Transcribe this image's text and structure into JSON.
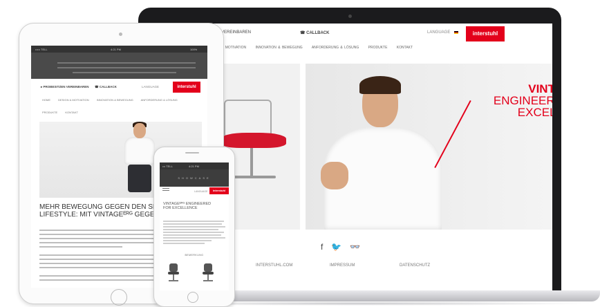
{
  "colors": {
    "brand_red": "#e3001b",
    "laptop_bezel": "#1b1b1d",
    "device_silver": "#fbfbfb"
  },
  "laptop": {
    "top_bar": {
      "appointment": "N VEREINBAREN",
      "callback": "CALLBACK",
      "language": "LANGUAGE",
      "logo": "interstuhl"
    },
    "nav": [
      "N & MOTIVATION",
      "INNOVATION & BEWEGUNG",
      "ANFORDERUNG & LÖSUNG",
      "PRODUKTE",
      "KONTAKT"
    ],
    "hero": {
      "line1": "VINTA",
      "line2": "ENGINEERE",
      "line3": "EXCELL"
    },
    "social_icons": [
      "facebook-icon",
      "twitter-icon",
      "tripadvisor-icon"
    ],
    "footer": [
      "INTERSTUHL.COM",
      "IMPRESSUM",
      "DATENSCHUTZ"
    ]
  },
  "tablet": {
    "status": {
      "carrier": "••••• TELL",
      "time": "4:21 PM",
      "battery": "100%"
    },
    "top_bar": {
      "appointment": "PROBESITZEN VEREINBAREN",
      "callback": "CALLBACK",
      "language": "LANGUAGE",
      "logo": "interstuhl"
    },
    "nav_row1": [
      "HOME",
      "DESIGN & MOTIVATION",
      "INNOVATION & BEWEGUNG",
      "ANFORDERUNG & LÖSUNG"
    ],
    "nav_row2": [
      "PRODUKTE",
      "KONTAKT"
    ],
    "headline": "MEHR BEWEGUNG GEGEN DEN SEDEN LIFESTYLE: MIT VINTAGEᴱᴿᴳ GEGEN DAS SITZEN"
  },
  "phone": {
    "status": {
      "carrier": "••• TELL",
      "time": "4:21 PM"
    },
    "nav_title": "SHOWCASE",
    "language": "LANGUAGE",
    "logo": "interstuhl",
    "headline": "VINTAGEᴱᴿᴳ ENGINEERED FOR EXCELLENCE",
    "sub": "BEMERKUNG"
  }
}
